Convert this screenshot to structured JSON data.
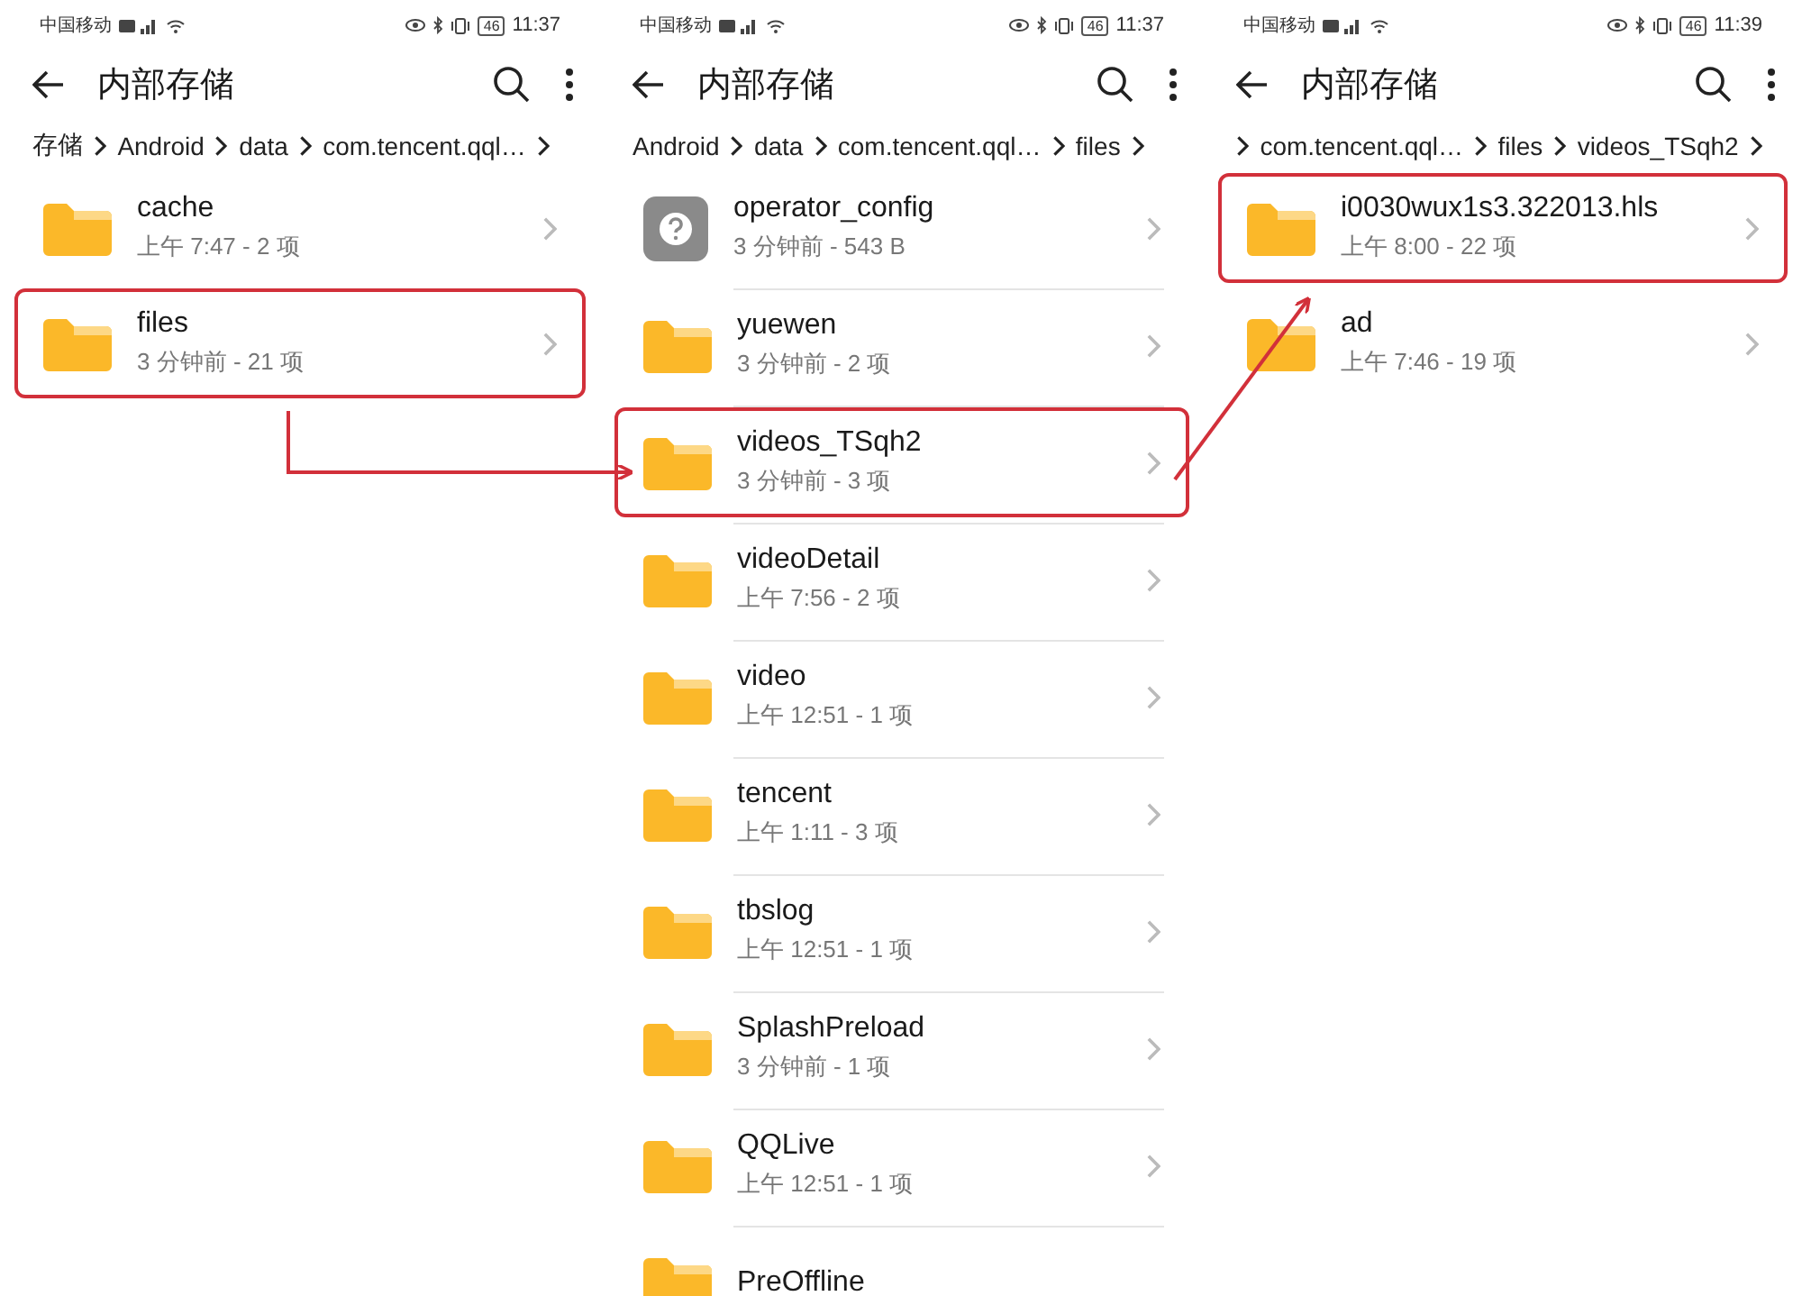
{
  "panels": [
    {
      "status": {
        "carrier": "中国移动",
        "battery": "46",
        "time": "11:37"
      },
      "title": "内部存储",
      "breadcrumb": {
        "leading_chevron": false,
        "segments": [
          "存储",
          "Android",
          "data",
          "com.tencent.qql…"
        ]
      },
      "dividers": false,
      "items": [
        {
          "kind": "folder",
          "name": "cache",
          "meta": "上午 7:47 - 2 项",
          "highlighted": false
        },
        {
          "kind": "folder",
          "name": "files",
          "meta": "3 分钟前 - 21 项",
          "highlighted": true
        }
      ]
    },
    {
      "status": {
        "carrier": "中国移动",
        "battery": "46",
        "time": "11:37"
      },
      "title": "内部存储",
      "breadcrumb": {
        "leading_chevron": false,
        "segments": [
          "Android",
          "data",
          "com.tencent.qql…",
          "files"
        ]
      },
      "dividers": true,
      "items": [
        {
          "kind": "unknown",
          "name": "operator_config",
          "meta": "3 分钟前 - 543 B",
          "highlighted": false
        },
        {
          "kind": "folder",
          "name": "yuewen",
          "meta": "3 分钟前 - 2 项",
          "highlighted": false
        },
        {
          "kind": "folder",
          "name": "videos_TSqh2",
          "meta": "3 分钟前 - 3 项",
          "highlighted": true
        },
        {
          "kind": "folder",
          "name": "videoDetail",
          "meta": "上午 7:56 - 2 项",
          "highlighted": false
        },
        {
          "kind": "folder",
          "name": "video",
          "meta": "上午 12:51 - 1 项",
          "highlighted": false
        },
        {
          "kind": "folder",
          "name": "tencent",
          "meta": "上午 1:11 - 3 项",
          "highlighted": false
        },
        {
          "kind": "folder",
          "name": "tbslog",
          "meta": "上午 12:51 - 1 项",
          "highlighted": false
        },
        {
          "kind": "folder",
          "name": "SplashPreload",
          "meta": "3 分钟前 - 1 项",
          "highlighted": false
        },
        {
          "kind": "folder",
          "name": "QQLive",
          "meta": "上午 12:51 - 1 项",
          "highlighted": false
        },
        {
          "kind": "folder",
          "name": "PreOffline",
          "highlighted": false
        }
      ]
    },
    {
      "status": {
        "carrier": "中国移动",
        "battery": "46",
        "time": "11:39"
      },
      "title": "内部存储",
      "breadcrumb": {
        "leading_chevron": true,
        "segments": [
          "com.tencent.qql…",
          "files",
          "videos_TSqh2"
        ]
      },
      "dividers": false,
      "items": [
        {
          "kind": "folder",
          "name": "i0030wux1s3.322013.hls",
          "meta": "上午 8:00 - 22 项",
          "highlighted": true
        },
        {
          "kind": "folder",
          "name": "ad",
          "meta": "上午 7:46 - 19 项",
          "highlighted": false
        }
      ]
    }
  ]
}
